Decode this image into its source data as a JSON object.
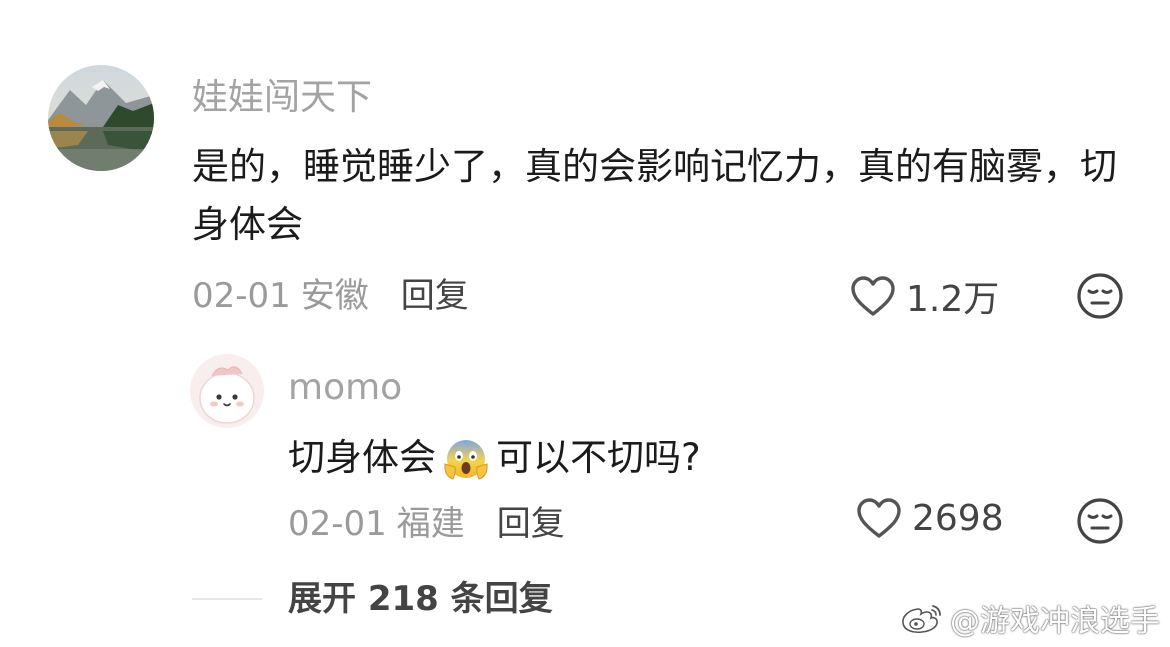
{
  "comment": {
    "username": "娃娃闯天下",
    "text": "是的，睡觉睡少了，真的会影响记忆力，真的有脑雾，切身体会",
    "date": "02-01",
    "location": "安徽",
    "reply_label": "回复",
    "likes": "1.2万"
  },
  "reply": {
    "username": "momo",
    "text_before": "切身体会",
    "emoji": "screaming-face-emoji",
    "text_after": "可以不切吗?",
    "date": "02-01",
    "location": "福建",
    "reply_label": "回复",
    "likes": "2698"
  },
  "expand": {
    "label": "展开 218 条回复"
  },
  "watermark": {
    "text": "@游戏冲浪选手"
  },
  "icons": {
    "like": "heart-outline-icon",
    "reaction": "neutral-face-icon"
  },
  "colors": {
    "username": "#a3a3a3",
    "meta": "#9a9a9a",
    "text": "#1b1b1b",
    "action": "#444444"
  }
}
